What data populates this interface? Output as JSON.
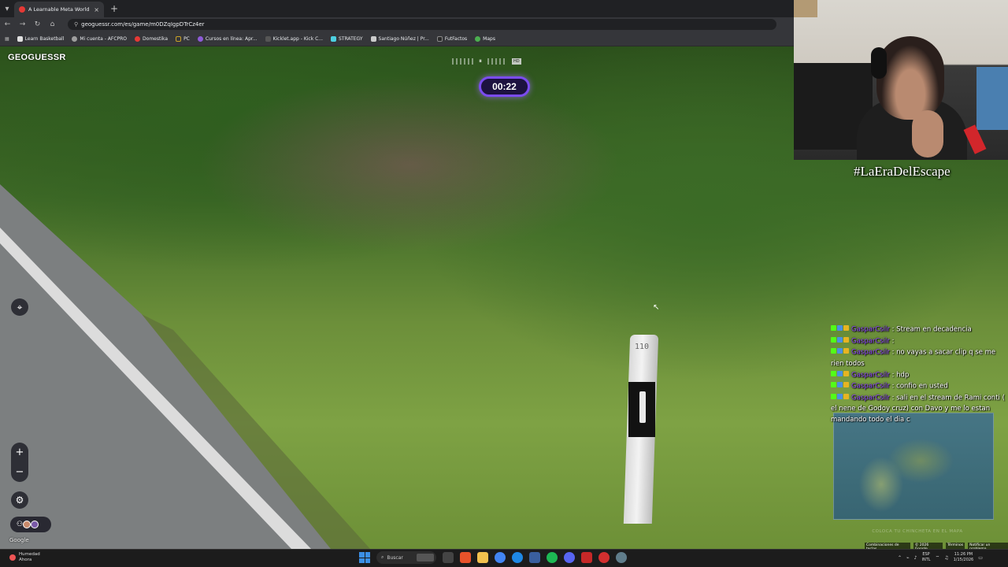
{
  "browser": {
    "tab_title": "A Learnable Meta World - Begi",
    "tab_close": "×",
    "new_tab": "+",
    "url": "geoguessr.com/es/game/m0DZqIgpDTrCz4er",
    "nav": {
      "back": "←",
      "forward": "→",
      "reload": "↻",
      "home": "⌂"
    },
    "bookmarks": [
      {
        "label": "Learn Basketball",
        "color": "#e0e0e0"
      },
      {
        "label": "Mi cuenta - AFCPRO",
        "color": "#9e9e9e"
      },
      {
        "label": "Domestika",
        "color": "#e53935"
      },
      {
        "label": "PC",
        "color": "#c9a227"
      },
      {
        "label": "Cursos en línea: Apr...",
        "color": "#8e5bd8"
      },
      {
        "label": "Kicklet.app - Kick C...",
        "color": "#555555"
      },
      {
        "label": "STRATEGY",
        "color": "#4dd0e1"
      },
      {
        "label": "Santiago Núñez | Pr...",
        "color": "#cccccc"
      },
      {
        "label": "FutFactos",
        "color": "#2b2b2b"
      },
      {
        "label": "Maps",
        "color": "#4caf50"
      }
    ]
  },
  "game": {
    "logo": "GEOGUESSR",
    "timer": "00:22",
    "progress_pause": "⏸",
    "progress_hd": "HD",
    "km_marker": "110",
    "controls": {
      "compass": "⌖",
      "zoom_in": "+",
      "zoom_out": "−",
      "settings": "⚙",
      "party": "⚇"
    },
    "google_watermark": "Google",
    "minimap_cta": "COLOCA TU CHINCHETA EN EL MAPA",
    "map_footer": [
      "Combinaciones de teclas",
      "© 2026 Google",
      "Términos",
      "Notificar un problema"
    ]
  },
  "stream": {
    "hashtag": "#LaEraDelEscape",
    "chat": [
      {
        "user": "GasparCsilr",
        "text": ": Stream en decadencia"
      },
      {
        "user": "GasparCsilr",
        "text": ":"
      },
      {
        "user": "GasparCsilr",
        "text": ": no vayas a sacar clip q se me rien todos"
      },
      {
        "user": "GasparCsilr",
        "text": ": hdp"
      },
      {
        "user": "GasparCsilr",
        "text": ": confio en usted"
      },
      {
        "user": "GasparCsilr",
        "text": ": sali en el stream de Rami conti ( el nene de Godoy cruz) con Davo y me lo estan mandando todo el dia c"
      }
    ]
  },
  "taskbar": {
    "weather_title": "Humedad",
    "weather_sub": "Ahora",
    "search_placeholder": "Buscar",
    "lang": "ESP",
    "lang_sub": "INTL",
    "time": "11:26 PM",
    "date": "1/15/2026",
    "colors": {
      "start": "#3b8fe6"
    }
  }
}
